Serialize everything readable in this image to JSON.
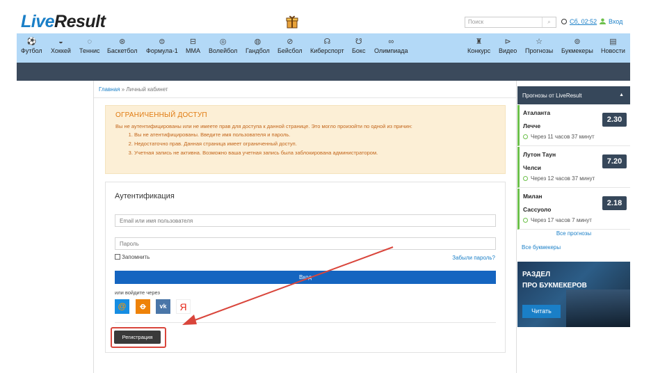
{
  "header": {
    "logo_live": "Live",
    "logo_result": "Result",
    "search_placeholder": "Поиск",
    "clock": "Сб, 02:52",
    "login": "Вход"
  },
  "sports": [
    {
      "label": "Футбол",
      "icon": "football-icon"
    },
    {
      "label": "Хоккей",
      "icon": "hockey-icon"
    },
    {
      "label": "Теннис",
      "icon": "tennis-icon"
    },
    {
      "label": "Баскетбол",
      "icon": "basketball-icon"
    },
    {
      "label": "Формула-1",
      "icon": "formula1-icon"
    },
    {
      "label": "MMA",
      "icon": "mma-icon"
    },
    {
      "label": "Волейбол",
      "icon": "volleyball-icon"
    },
    {
      "label": "Гандбол",
      "icon": "handball-icon"
    },
    {
      "label": "Бейсбол",
      "icon": "baseball-icon"
    },
    {
      "label": "Киберспорт",
      "icon": "esports-icon"
    },
    {
      "label": "Бокс",
      "icon": "boxing-icon"
    },
    {
      "label": "Олимпиада",
      "icon": "olympics-icon"
    }
  ],
  "extra_nav": [
    {
      "label": "Конкурс",
      "icon": "trophy-icon"
    },
    {
      "label": "Видео",
      "icon": "play-icon"
    },
    {
      "label": "Прогнозы",
      "icon": "star-icon"
    },
    {
      "label": "Букмекеры",
      "icon": "money-icon"
    },
    {
      "label": "Новости",
      "icon": "news-icon"
    }
  ],
  "breadcrumb": {
    "home": "Главная",
    "separator": "»",
    "current": "Личный кабинет"
  },
  "warning": {
    "title": "ОГРАНИЧЕННЫЙ ДОСТУП",
    "intro": "Вы не аутентифицированы или не имеете прав для доступа к данной странице. Это могло произойти по одной из причин:",
    "reasons": [
      "Вы не атентифицированы. Введите имя пользователя и пароль.",
      "Недостаточно прав. Данная страница имеет ограниченный доступ.",
      "Учетная запись не активна. Возможно ваша учетная запись была заблокирована администратором."
    ]
  },
  "auth": {
    "title": "Аутентификация",
    "email_placeholder": "Email или имя пользователя",
    "password_placeholder": "Пароль",
    "remember": "Запомнить",
    "forgot": "Забыли пароль?",
    "login_button": "Вход",
    "or_via": "или войдите через",
    "register_button": "Регистрация"
  },
  "sidebar": {
    "tips_title": "Прогнозы от LiveResult",
    "tips": [
      {
        "team1": "Аталанта",
        "team2": "Лечче",
        "time": "Через 11 часов 37 минут",
        "odds": "2.30"
      },
      {
        "team1": "Лутон Таун",
        "team2": "Челси",
        "time": "Через 12 часов 37 минут",
        "odds": "7.20"
      },
      {
        "team1": "Милан",
        "team2": "Сассуоло",
        "time": "Через 17 часов 7 минут",
        "odds": "2.18"
      }
    ],
    "all_tips": "Все прогнозы",
    "all_bookmakers": "Все букмекеры",
    "banner_line1": "РАЗДЕЛ",
    "banner_line2": "ПРО БУКМЕКЕРОВ",
    "banner_button": "Читать"
  },
  "colors": {
    "nav_bg": "#b3d9f7",
    "dark_bar": "#3b4a5c",
    "brand_blue": "#1a7fc7",
    "warning_bg": "#fcefd6",
    "highlight_red": "#d9453b"
  }
}
